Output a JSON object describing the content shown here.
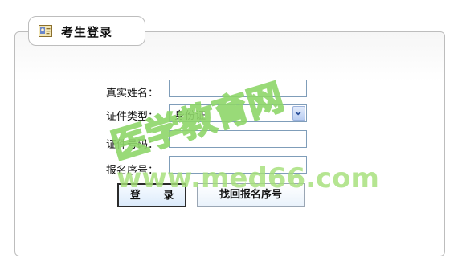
{
  "panel": {
    "title": "考生登录",
    "title_icon": "id-card-icon"
  },
  "form": {
    "name_label": "真实姓名：",
    "name_value": "",
    "id_type_label": "证件类型：",
    "id_type_value": "身份证",
    "id_number_label": "证件号码：",
    "id_number_value": "",
    "serial_label": "报名序号：",
    "serial_value": ""
  },
  "buttons": {
    "login_label": "登 录",
    "recover_label": "找回报名序号"
  },
  "watermark": {
    "cn_text": "医学教育网",
    "url_text": "www.med66.com",
    "color": "#8fd66a"
  }
}
